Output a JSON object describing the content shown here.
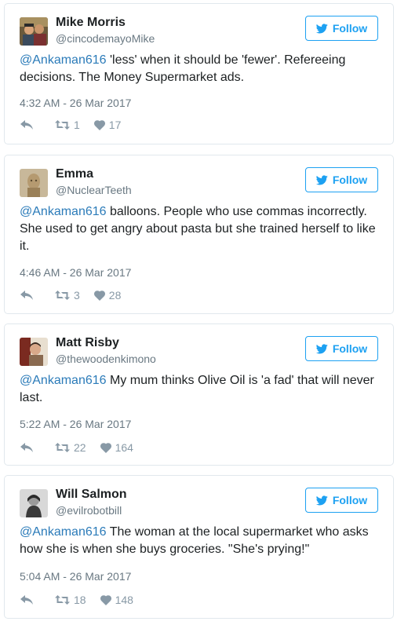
{
  "colors": {
    "accent": "#1da1f2",
    "mention": "#2b7bb9",
    "muted": "#697882",
    "icon": "#8899a6",
    "border": "#e1e8ed"
  },
  "follow_icon": "twitter-bird-icon",
  "tweets": [
    {
      "name": "Mike Morris",
      "handle": "@cincodemayoMike",
      "follow_label": "Follow",
      "mention": "@Ankaman616",
      "text": " 'less' when it should be 'fewer'. Refereeing decisions. The Money Supermarket ads.",
      "timestamp": "4:32 AM - 26 Mar 2017",
      "retweets": "1",
      "likes": "17"
    },
    {
      "name": "Emma",
      "handle": "@NuclearTeeth",
      "follow_label": "Follow",
      "mention": "@Ankaman616",
      "text": " balloons. People who use commas incorrectly. She used to get angry about pasta but she trained herself to like it.",
      "timestamp": "4:46 AM - 26 Mar 2017",
      "retweets": "3",
      "likes": "28"
    },
    {
      "name": "Matt Risby",
      "handle": "@thewoodenkimono",
      "follow_label": "Follow",
      "mention": "@Ankaman616",
      "text": " My mum thinks Olive Oil is 'a fad' that will never last.",
      "timestamp": "5:22 AM - 26 Mar 2017",
      "retweets": "22",
      "likes": "164"
    },
    {
      "name": "Will Salmon",
      "handle": "@evilrobotbill",
      "follow_label": "Follow",
      "mention": "@Ankaman616",
      "text": " The woman at the local supermarket who asks how she is when she buys groceries. \"She's prying!\"",
      "timestamp": "5:04 AM - 26 Mar 2017",
      "retweets": "18",
      "likes": "148"
    }
  ]
}
